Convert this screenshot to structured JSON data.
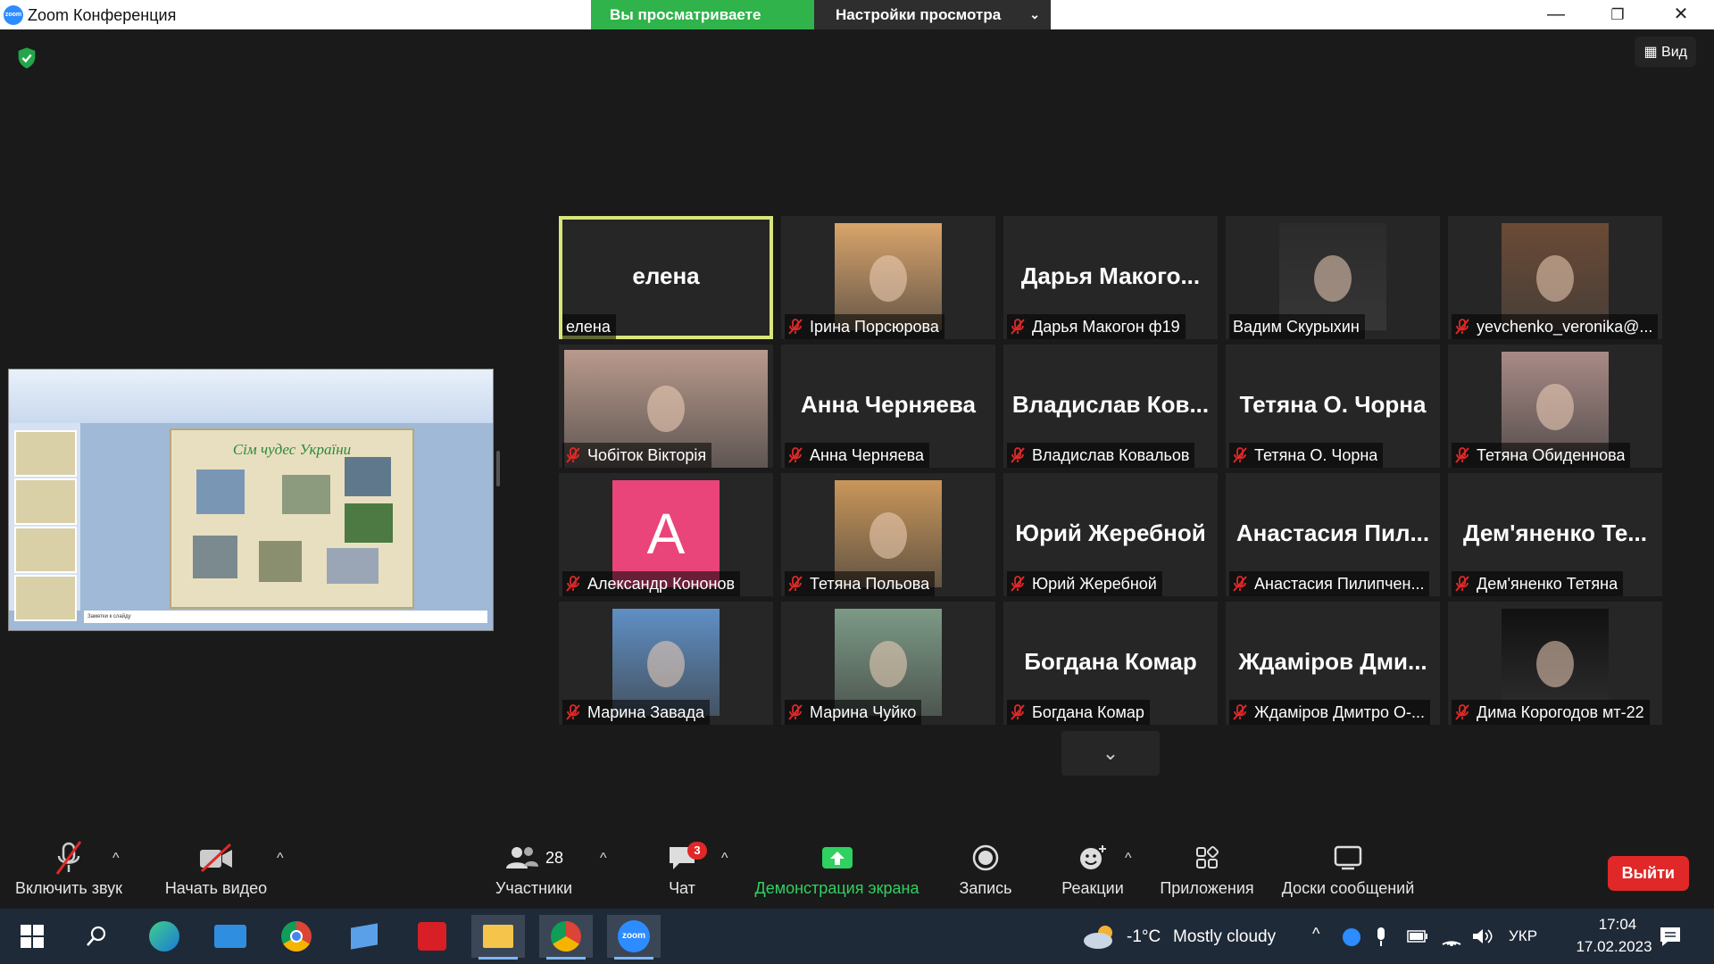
{
  "window": {
    "title": "Zoom Конференция",
    "logo_text": "zoom",
    "minimize": "—",
    "restore": "❐",
    "close": "✕"
  },
  "share_banner": {
    "viewing_text": "Вы просматриваете экран елена",
    "view_options": "Настройки просмотра"
  },
  "view_button": "Вид",
  "shared_screen": {
    "slide_title": "Сім чудес України",
    "notes_placeholder": "Заметки к слайду"
  },
  "participants": [
    {
      "big": "елена",
      "label": "елена",
      "muted": false,
      "speaker": true,
      "photo": null
    },
    {
      "big": "",
      "label": "Ірина Порсюрова",
      "muted": true,
      "photo": "portrait",
      "photo_color": "#d9a46b"
    },
    {
      "big": "Дарья Макого...",
      "label": "Дарья Макогон ф19",
      "muted": true,
      "photo": null
    },
    {
      "big": "",
      "label": "Вадим Скурыхин",
      "muted": false,
      "photo": "portrait",
      "photo_color": "#2b2b2b"
    },
    {
      "big": "",
      "label": "yevchenko_veronika@...",
      "muted": true,
      "photo": "portrait",
      "photo_color": "#6b4a35"
    },
    {
      "big": "",
      "label": "Чобіток Вікторія",
      "muted": true,
      "photo": "full",
      "photo_color": "#b99a8c"
    },
    {
      "big": "Анна Черняева",
      "label": "Анна Черняева",
      "muted": true,
      "photo": null
    },
    {
      "big": "Владислав Ков...",
      "label": "Владислав Ковальов",
      "muted": true,
      "photo": null
    },
    {
      "big": "Тетяна О. Чорна",
      "label": "Тетяна О. Чорна",
      "muted": true,
      "photo": null
    },
    {
      "big": "",
      "label": "Тетяна Обиденнова",
      "muted": true,
      "photo": "portrait",
      "photo_color": "#a88a86"
    },
    {
      "big": "",
      "label": "Александр Кононов",
      "muted": true,
      "photo": "avatar",
      "avatar_letter": "A",
      "photo_color": "#e9457a"
    },
    {
      "big": "",
      "label": "Тетяна Польова",
      "muted": true,
      "photo": "portrait",
      "photo_color": "#c9965a"
    },
    {
      "big": "Юрий Жеребной",
      "label": "Юрий Жеребной",
      "muted": true,
      "photo": null
    },
    {
      "big": "Анастасия Пил...",
      "label": "Анастасия Пилипчен...",
      "muted": true,
      "photo": null
    },
    {
      "big": "Дем'яненко Те...",
      "label": "Дем'яненко Тетяна",
      "muted": true,
      "photo": null
    },
    {
      "big": "",
      "label": "Марина Завада",
      "muted": true,
      "photo": "portrait",
      "photo_color": "#5f8fc4"
    },
    {
      "big": "",
      "label": "Марина Чуйко",
      "muted": true,
      "photo": "portrait",
      "photo_color": "#7c9a86"
    },
    {
      "big": "Богдана Комар",
      "label": "Богдана Комар",
      "muted": true,
      "photo": null
    },
    {
      "big": "Ждаміров Дми...",
      "label": "Ждаміров Дмитро О-...",
      "muted": true,
      "photo": null
    },
    {
      "big": "",
      "label": "Дима Корогодов мт-22",
      "muted": true,
      "photo": "portrait",
      "photo_color": "#111111"
    }
  ],
  "toolbar": {
    "unmute": "Включить звук",
    "start_video": "Начать видео",
    "participants": "Участники",
    "participants_count": "28",
    "chat": "Чат",
    "chat_badge": "3",
    "share_screen": "Демонстрация экрана",
    "record": "Запись",
    "reactions": "Реакции",
    "apps": "Приложения",
    "whiteboards": "Доски сообщений",
    "leave": "Выйти"
  },
  "taskbar": {
    "weather_temp": "-1°C",
    "weather_text": "Mostly cloudy",
    "language": "УКР",
    "time": "17:04",
    "date": "17.02.2023"
  },
  "colors": {
    "accent_green": "#2fb34a",
    "speaker_border": "#d9e67a",
    "mute_red": "#e02828"
  }
}
